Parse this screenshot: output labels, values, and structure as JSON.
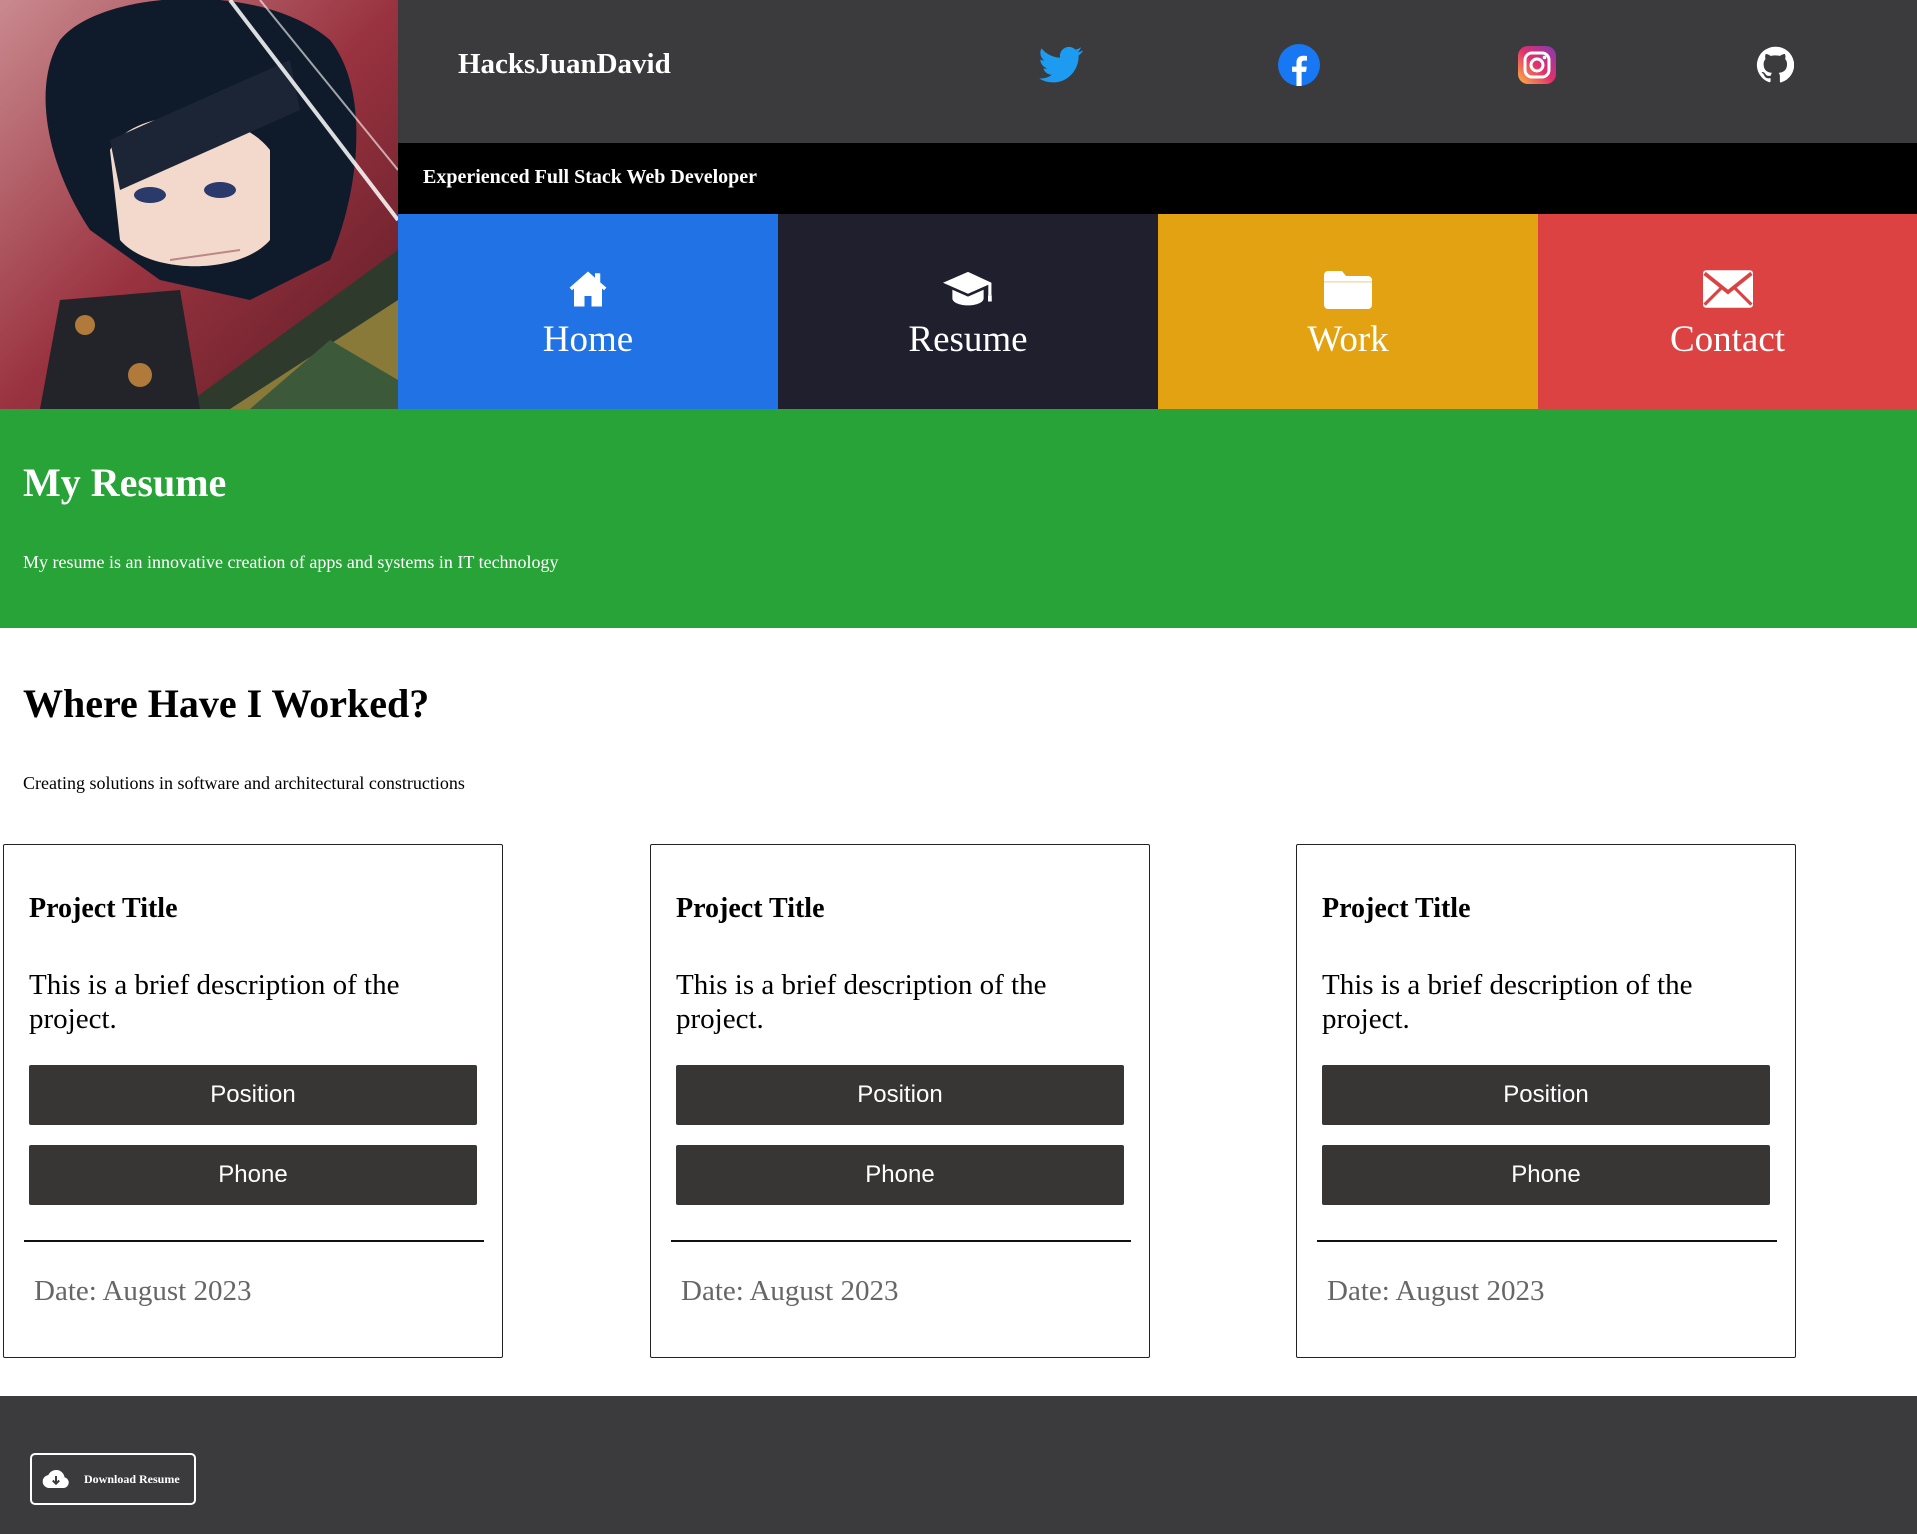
{
  "header": {
    "brand": "HacksJuanDavid",
    "tagline": "Experienced Full Stack Web Developer",
    "social": [
      {
        "name": "twitter-icon",
        "color": "#1d9bf0"
      },
      {
        "name": "facebook-icon",
        "color": "#1877f2"
      },
      {
        "name": "instagram-icon",
        "color": "#e1306c"
      },
      {
        "name": "github-icon",
        "color": "#ffffff"
      }
    ]
  },
  "nav": {
    "items": [
      {
        "label": "Home",
        "icon": "home-icon",
        "color": "#2172e5"
      },
      {
        "label": "Resume",
        "icon": "graduation-cap-icon",
        "color": "#201f2e"
      },
      {
        "label": "Work",
        "icon": "folder-icon",
        "color": "#e2a212"
      },
      {
        "label": "Contact",
        "icon": "envelope-icon",
        "color": "#dd4242"
      }
    ]
  },
  "hero": {
    "title": "My Resume",
    "text": "My resume is an innovative creation of apps and systems in IT technology",
    "color": "#27a338"
  },
  "work": {
    "title": "Where Have I Worked?",
    "text": "Creating solutions in software and architectural constructions",
    "cards": [
      {
        "title": "Project Title",
        "description": "This is a brief description of the project.",
        "position_label": "Position",
        "phone_label": "Phone",
        "date": "Date: August 2023"
      },
      {
        "title": "Project Title",
        "description": "This is a brief description of the project.",
        "position_label": "Position",
        "phone_label": "Phone",
        "date": "Date: August 2023"
      },
      {
        "title": "Project Title",
        "description": "This is a brief description of the project.",
        "position_label": "Position",
        "phone_label": "Phone",
        "date": "Date: August 2023"
      }
    ]
  },
  "footer": {
    "download_label": "Download Resume",
    "download_icon": "cloud-download-icon"
  }
}
